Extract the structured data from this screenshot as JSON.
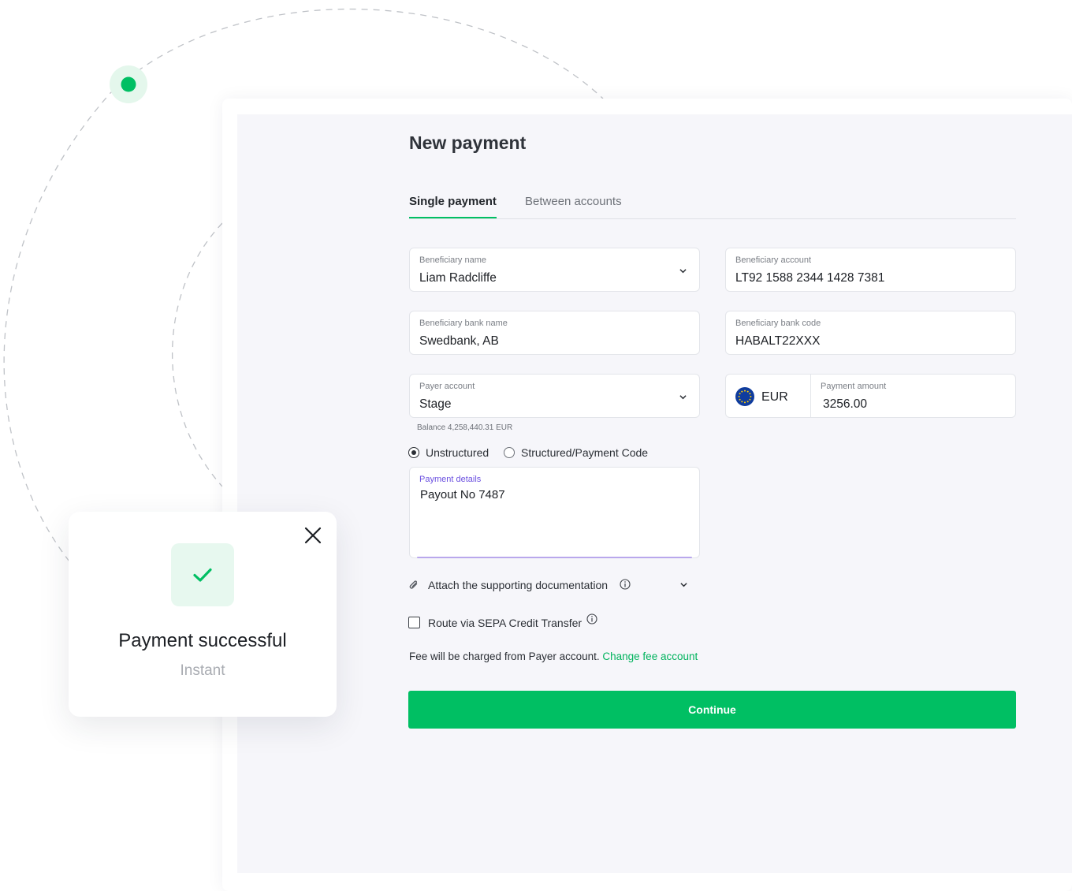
{
  "page": {
    "title": "New payment",
    "tabs": [
      {
        "label": "Single payment",
        "active": true
      },
      {
        "label": "Between accounts",
        "active": false
      }
    ]
  },
  "form": {
    "beneficiary_name": {
      "label": "Beneficiary name",
      "value": "Liam Radcliffe"
    },
    "beneficiary_account": {
      "label": "Beneficiary account",
      "value": "LT92 1588 2344 1428 7381"
    },
    "beneficiary_bank_name": {
      "label": "Beneficiary bank name",
      "value": "Swedbank, AB"
    },
    "beneficiary_bank_code": {
      "label": "Beneficiary bank code",
      "value": "HABALT22XXX"
    },
    "payer_account": {
      "label": "Payer account",
      "value": "Stage",
      "balance": "Balance 4,258,440.31 EUR"
    },
    "currency": {
      "code": "EUR",
      "icon": "eu-flag-icon"
    },
    "payment_amount": {
      "label": "Payment amount",
      "value": "3256.00"
    },
    "details_type": {
      "options": [
        {
          "label": "Unstructured",
          "selected": true
        },
        {
          "label": "Structured/Payment Code",
          "selected": false
        }
      ]
    },
    "payment_details": {
      "label": "Payment details",
      "value": "Payout No 7487"
    },
    "attach": {
      "label": "Attach the supporting documentation"
    },
    "sepa": {
      "label": "Route via SEPA Credit Transfer",
      "checked": false
    },
    "fee": {
      "text": "Fee will be charged from Payer account.",
      "link": "Change fee account"
    },
    "continue_label": "Continue"
  },
  "toast": {
    "title": "Payment successful",
    "subtitle": "Instant"
  },
  "colors": {
    "accent": "#00bf63",
    "panel_bg": "#f6f6fa",
    "focus_label": "#6a4fe0"
  }
}
